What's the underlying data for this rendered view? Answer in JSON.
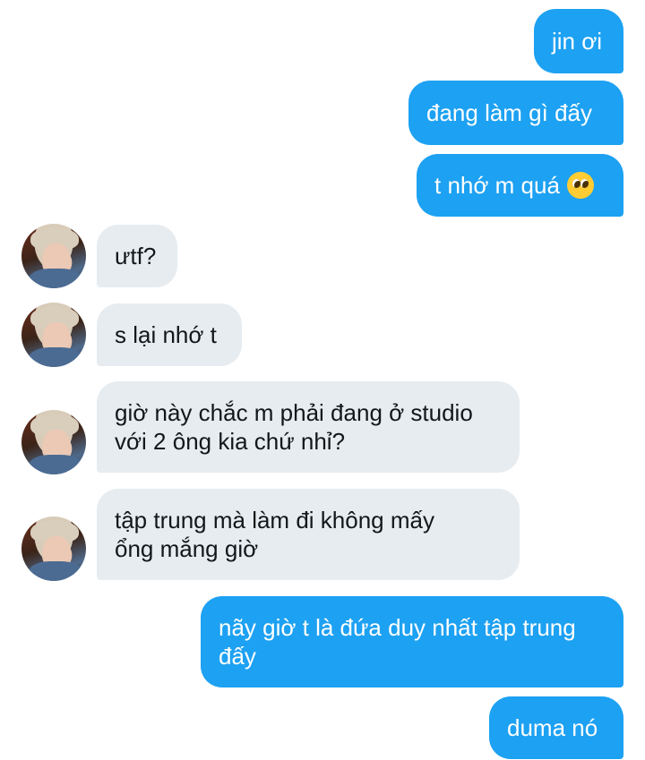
{
  "colors": {
    "sent_bubble": "#1da1f2",
    "received_bubble": "#e6ecf0",
    "sent_text": "#ffffff",
    "received_text": "#14171a"
  },
  "messages": [
    {
      "direction": "sent",
      "text": "jin ơi"
    },
    {
      "direction": "sent",
      "text": "đang làm gì đấy"
    },
    {
      "direction": "sent",
      "text": "t nhớ m quá",
      "emoji": "pleading-face-emoji"
    },
    {
      "direction": "received",
      "text": "ưtf?"
    },
    {
      "direction": "received",
      "text": "s lại nhớ t"
    },
    {
      "direction": "received",
      "text": "giờ này chắc m phải đang ở studio\nvới 2 ông kia chứ nhỉ?"
    },
    {
      "direction": "received",
      "text": "tập trung mà làm đi không mấy\nổng mắng giờ"
    },
    {
      "direction": "sent",
      "text": "nãy giờ t là đứa duy nhất tập trung\nđấy"
    },
    {
      "direction": "sent",
      "text": "duma nó"
    }
  ]
}
